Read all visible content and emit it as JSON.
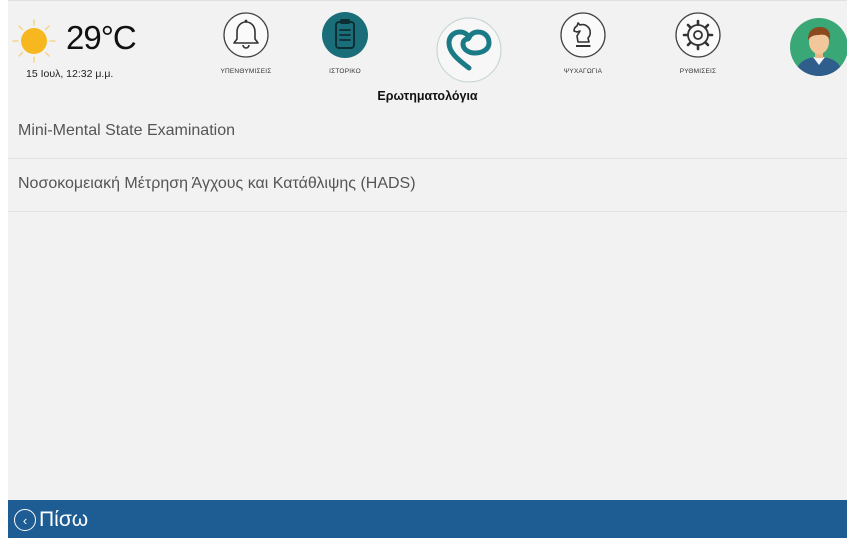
{
  "header": {
    "temperature": "29°C",
    "datetime": "15 Ιουλ, 12:32 μ.μ.",
    "weather_icon": "sun-icon",
    "nav": [
      {
        "label": "ΥΠΕΝΘΥΜΙΣΕΙΣ",
        "icon": "bell-icon"
      },
      {
        "label": "ΙΣΤΟΡΙΚΟ",
        "icon": "clipboard-icon"
      },
      {
        "label": "",
        "icon": "heart-logo-icon"
      },
      {
        "label": "ΨΥΧΑΓΩΓΙΑ",
        "icon": "chess-knight-icon"
      },
      {
        "label": "ΡΥΘΜΙΣΕΙΣ",
        "icon": "gear-icon"
      }
    ]
  },
  "content": {
    "title": "Ερωτηματολόγια",
    "items": [
      {
        "label": "Mini-Mental State Examination"
      },
      {
        "label": "Νοσοκομειακή Μέτρηση Άγχους και Κατάθλιψης (HADS)"
      }
    ]
  },
  "footer": {
    "back_label": "Πίσω"
  },
  "colors": {
    "footer_bg": "#1e5c94",
    "accent_teal": "#1a7a85",
    "sun": "#f6b81e",
    "avatar_bg": "#3aa776"
  }
}
